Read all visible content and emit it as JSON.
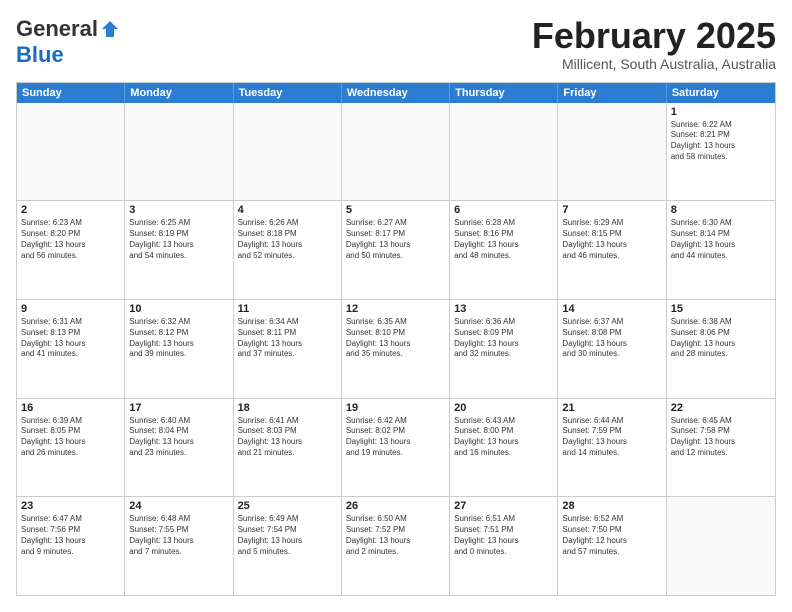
{
  "logo": {
    "general": "General",
    "blue": "Blue"
  },
  "title": "February 2025",
  "location": "Millicent, South Australia, Australia",
  "days": [
    "Sunday",
    "Monday",
    "Tuesday",
    "Wednesday",
    "Thursday",
    "Friday",
    "Saturday"
  ],
  "weeks": [
    [
      {
        "day": "",
        "info": ""
      },
      {
        "day": "",
        "info": ""
      },
      {
        "day": "",
        "info": ""
      },
      {
        "day": "",
        "info": ""
      },
      {
        "day": "",
        "info": ""
      },
      {
        "day": "",
        "info": ""
      },
      {
        "day": "1",
        "info": "Sunrise: 6:22 AM\nSunset: 8:21 PM\nDaylight: 13 hours\nand 58 minutes."
      }
    ],
    [
      {
        "day": "2",
        "info": "Sunrise: 6:23 AM\nSunset: 8:20 PM\nDaylight: 13 hours\nand 56 minutes."
      },
      {
        "day": "3",
        "info": "Sunrise: 6:25 AM\nSunset: 8:19 PM\nDaylight: 13 hours\nand 54 minutes."
      },
      {
        "day": "4",
        "info": "Sunrise: 6:26 AM\nSunset: 8:18 PM\nDaylight: 13 hours\nand 52 minutes."
      },
      {
        "day": "5",
        "info": "Sunrise: 6:27 AM\nSunset: 8:17 PM\nDaylight: 13 hours\nand 50 minutes."
      },
      {
        "day": "6",
        "info": "Sunrise: 6:28 AM\nSunset: 8:16 PM\nDaylight: 13 hours\nand 48 minutes."
      },
      {
        "day": "7",
        "info": "Sunrise: 6:29 AM\nSunset: 8:15 PM\nDaylight: 13 hours\nand 46 minutes."
      },
      {
        "day": "8",
        "info": "Sunrise: 6:30 AM\nSunset: 8:14 PM\nDaylight: 13 hours\nand 44 minutes."
      }
    ],
    [
      {
        "day": "9",
        "info": "Sunrise: 6:31 AM\nSunset: 8:13 PM\nDaylight: 13 hours\nand 41 minutes."
      },
      {
        "day": "10",
        "info": "Sunrise: 6:32 AM\nSunset: 8:12 PM\nDaylight: 13 hours\nand 39 minutes."
      },
      {
        "day": "11",
        "info": "Sunrise: 6:34 AM\nSunset: 8:11 PM\nDaylight: 13 hours\nand 37 minutes."
      },
      {
        "day": "12",
        "info": "Sunrise: 6:35 AM\nSunset: 8:10 PM\nDaylight: 13 hours\nand 35 minutes."
      },
      {
        "day": "13",
        "info": "Sunrise: 6:36 AM\nSunset: 8:09 PM\nDaylight: 13 hours\nand 32 minutes."
      },
      {
        "day": "14",
        "info": "Sunrise: 6:37 AM\nSunset: 8:08 PM\nDaylight: 13 hours\nand 30 minutes."
      },
      {
        "day": "15",
        "info": "Sunrise: 6:38 AM\nSunset: 8:06 PM\nDaylight: 13 hours\nand 28 minutes."
      }
    ],
    [
      {
        "day": "16",
        "info": "Sunrise: 6:39 AM\nSunset: 8:05 PM\nDaylight: 13 hours\nand 26 minutes."
      },
      {
        "day": "17",
        "info": "Sunrise: 6:40 AM\nSunset: 8:04 PM\nDaylight: 13 hours\nand 23 minutes."
      },
      {
        "day": "18",
        "info": "Sunrise: 6:41 AM\nSunset: 8:03 PM\nDaylight: 13 hours\nand 21 minutes."
      },
      {
        "day": "19",
        "info": "Sunrise: 6:42 AM\nSunset: 8:02 PM\nDaylight: 13 hours\nand 19 minutes."
      },
      {
        "day": "20",
        "info": "Sunrise: 6:43 AM\nSunset: 8:00 PM\nDaylight: 13 hours\nand 16 minutes."
      },
      {
        "day": "21",
        "info": "Sunrise: 6:44 AM\nSunset: 7:59 PM\nDaylight: 13 hours\nand 14 minutes."
      },
      {
        "day": "22",
        "info": "Sunrise: 6:45 AM\nSunset: 7:58 PM\nDaylight: 13 hours\nand 12 minutes."
      }
    ],
    [
      {
        "day": "23",
        "info": "Sunrise: 6:47 AM\nSunset: 7:56 PM\nDaylight: 13 hours\nand 9 minutes."
      },
      {
        "day": "24",
        "info": "Sunrise: 6:48 AM\nSunset: 7:55 PM\nDaylight: 13 hours\nand 7 minutes."
      },
      {
        "day": "25",
        "info": "Sunrise: 6:49 AM\nSunset: 7:54 PM\nDaylight: 13 hours\nand 5 minutes."
      },
      {
        "day": "26",
        "info": "Sunrise: 6:50 AM\nSunset: 7:52 PM\nDaylight: 13 hours\nand 2 minutes."
      },
      {
        "day": "27",
        "info": "Sunrise: 6:51 AM\nSunset: 7:51 PM\nDaylight: 13 hours\nand 0 minutes."
      },
      {
        "day": "28",
        "info": "Sunrise: 6:52 AM\nSunset: 7:50 PM\nDaylight: 12 hours\nand 57 minutes."
      },
      {
        "day": "",
        "info": ""
      }
    ]
  ]
}
